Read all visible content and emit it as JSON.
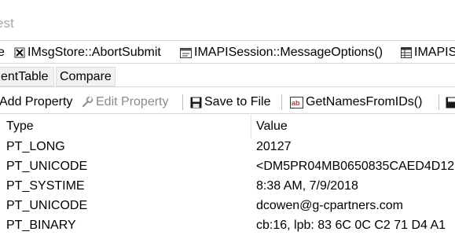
{
  "title_text": "est",
  "method_bar": {
    "items": [
      {
        "label": "e"
      },
      {
        "label": "IMsgStore::AbortSubmit",
        "icon": "stop-x-icon"
      },
      {
        "label": "IMAPISession::MessageOptions()",
        "icon": "dialog-icon"
      },
      {
        "label": "IMAPIS",
        "icon": "table-icon"
      }
    ]
  },
  "tabs": [
    {
      "label": "entTable"
    },
    {
      "label": "Compare"
    }
  ],
  "prop_toolbar": {
    "add_property": "Add Property",
    "edit_property": "Edit Property",
    "save_to_file": "Save to File",
    "get_names": "GetNamesFromIDs()"
  },
  "grid": {
    "columns": [
      "Type",
      "Value"
    ],
    "rows": [
      {
        "type": "PT_LONG",
        "value": "20127"
      },
      {
        "type": "PT_UNICODE",
        "value": "<DM5PR04MB0650835CAED4D12"
      },
      {
        "type": "PT_SYSTIME",
        "value": "8:38 AM, 7/9/2018"
      },
      {
        "type": "PT_UNICODE",
        "value": "dcowen@g-cpartners.com"
      },
      {
        "type": "PT_BINARY",
        "value": "cb:16, lpb: 83 6C 0C C2 71 D4 A1"
      }
    ]
  },
  "colors": {
    "accent_save": "#1a1a1a",
    "names_icon": "#c0392b",
    "disabled_text": "#8a8a8a"
  }
}
